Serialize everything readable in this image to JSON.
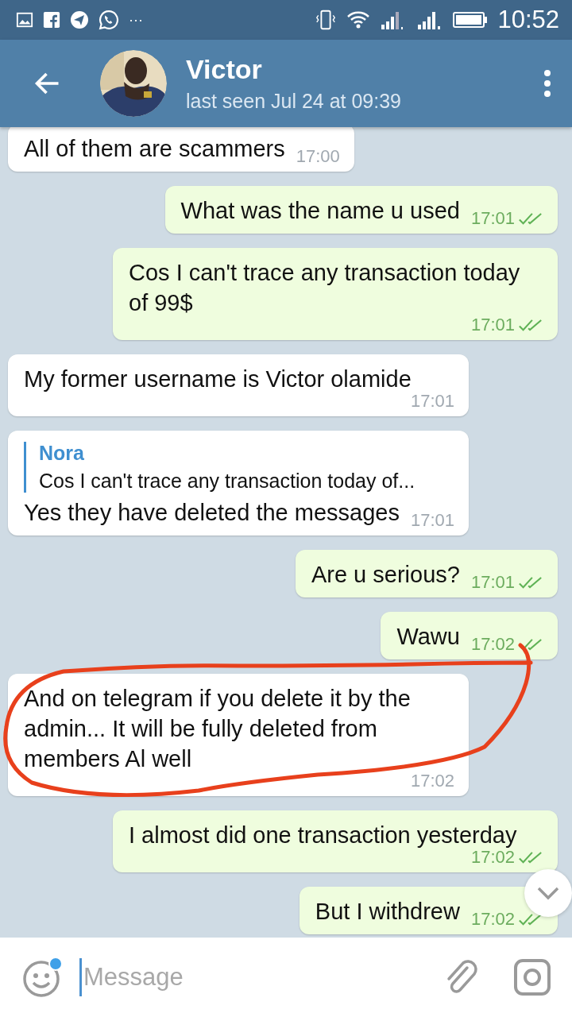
{
  "status_bar": {
    "overflow": "···",
    "time": "10:52"
  },
  "header": {
    "name": "Victor",
    "last_seen": "last seen Jul 24 at 09:39"
  },
  "messages": [
    {
      "kind": "incoming",
      "text": "All of them are scammers",
      "time": "17:00"
    },
    {
      "kind": "outgoing",
      "text": "What was the name u used",
      "time": "17:01",
      "read": true
    },
    {
      "kind": "outgoing",
      "text": "Cos I can't trace any transaction today of 99$",
      "time": "17:01",
      "read": true
    },
    {
      "kind": "incoming",
      "text": "My former username is Victor olamide",
      "time": "17:01"
    },
    {
      "kind": "incoming",
      "reply": {
        "author": "Nora",
        "text": "Cos I can't trace any transaction today of..."
      },
      "text": "Yes they have deleted the messages",
      "time": "17:01"
    },
    {
      "kind": "outgoing",
      "text": "Are u serious?",
      "time": "17:01",
      "read": true
    },
    {
      "kind": "outgoing",
      "text": "Wawu",
      "time": "17:02",
      "read": true
    },
    {
      "kind": "incoming",
      "text": "And on telegram if you delete it by the admin... It will be fully deleted from members Al well",
      "time": "17:02"
    },
    {
      "kind": "outgoing",
      "text": "I almost did one transaction yesterday",
      "time": "17:02",
      "read": true
    },
    {
      "kind": "outgoing",
      "text": "But I withdrew",
      "time": "17:02",
      "read": true
    }
  ],
  "composer": {
    "placeholder": "Message"
  }
}
